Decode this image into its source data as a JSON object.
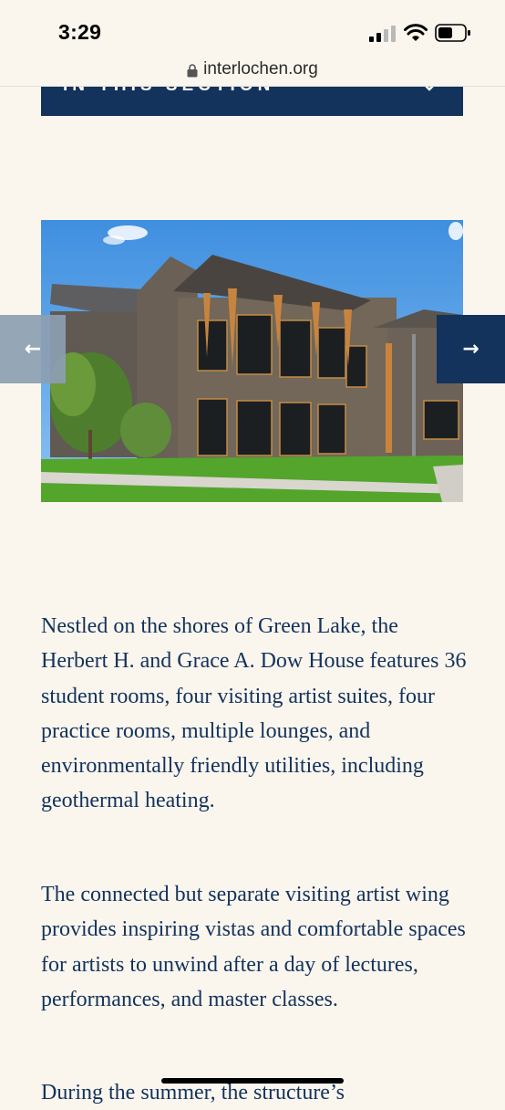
{
  "status_bar": {
    "time": "3:29"
  },
  "browser": {
    "url": "interlochen.org"
  },
  "section_nav": {
    "label": "IN THIS SECTION"
  },
  "carousel": {
    "image_alt": "Herbert H. and Grace A. Dow House",
    "prev_arrow": "←",
    "next_arrow": "→"
  },
  "content": {
    "paragraph_1": "Nestled on the shores of Green Lake, the Herbert H. and Grace A. Dow House features 36 student rooms, four visiting artist suites, four practice rooms, multiple lounges, and environmentally friendly utilities, including geothermal heating.",
    "paragraph_2": "The connected but separate visiting artist wing provides inspiring vistas and comfortable spaces for artists to unwind after a day of lectures, performances, and master classes.",
    "paragraph_3": "During the summer, the structure’s"
  },
  "colors": {
    "navy": "#13325c",
    "background": "#faf6ee"
  }
}
